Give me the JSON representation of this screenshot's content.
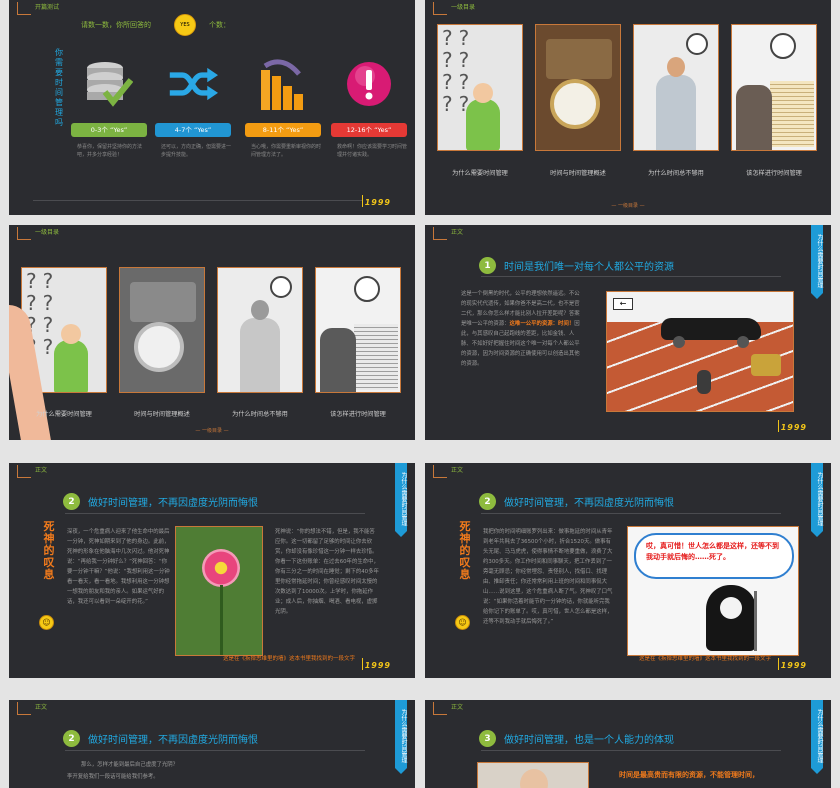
{
  "slide1": {
    "corner_label": "开篇测试",
    "quiz_prompt": "请数一数，你所回答的",
    "quiz_emoji": "YES",
    "quiz_unit": "个数：",
    "vertical_question": "你需要时间管理吗",
    "scores": [
      {
        "label": "0-3个 “Yes”",
        "color": "#7cb342",
        "icon": "database-check-icon",
        "desc": "恭喜你，保留并坚持你的方法吧，并多分享经验！"
      },
      {
        "label": "4-7个 “Yes”",
        "color": "#2196d3",
        "icon": "shuffle-icon",
        "desc": "还可以，方向正确，但需要进一步提升技能。"
      },
      {
        "label": "8-11个 “Yes”",
        "color": "#f39c12",
        "icon": "bar-chart-icon",
        "desc": "当心哦，你需要重新审视你的时间管理方法了。"
      },
      {
        "label": "12-16个 “Yes”",
        "color": "#e53935",
        "icon": "alert-icon",
        "desc": "救命啊！你应该需要学习时间管理并付诸实践。"
      }
    ],
    "logo": "1999"
  },
  "slide2": {
    "corner_label": "一级目录",
    "captions": [
      "为什么需要时间管理",
      "时间与时间管理概述",
      "为什么时间总不够用",
      "该怎样进行时间管理"
    ],
    "page_mark": "— 一级目录 —"
  },
  "slide3": {
    "corner_label": "一级目录",
    "captions": [
      "为什么需要时间管理",
      "时间与时间管理概述",
      "为什么时间总不够用",
      "该怎样进行时间管理"
    ],
    "page_mark": "— 一级目录 —"
  },
  "slide4": {
    "corner_label": "正文",
    "side_tab": "为什么需要时间管理",
    "number": "1",
    "heading": "时间是我们唯一对每个人都公平的资源",
    "body_before": "这是一个倒黑的时代，公平的理想依然遥远。不公的现实代代遗传，如果你爸不是高二代，也不是官二代，那么你怎么样才能比别人拉开差距呢？答案是唯一公平的资源：",
    "highlight": "这唯一公平的资源：时间！",
    "body_after": "因此，与其感叹自己起跑线的差距，比如金钱、人脉、不如好好把握住时间这个唯一对每个人都公平的资源，因为时间资源的正确使用可以创造出其他的资源。",
    "logo": "1999"
  },
  "slide5": {
    "corner_label": "正文",
    "side_tab": "为什么需要时间管理",
    "number": "2",
    "heading": "做好时间管理，不再因虚度光阴而悔恨",
    "death_title": "死神的叹息",
    "left_text": "深夜，一个危重病人迎来了他生命中的最后一分钟，死神如期来到了他的身边。此前，死神的形象在他脑海中几次闪过。他对死神说：“再给我一分钟好么？”死神回答：“你要一分钟干嘛？”他说：“我想利用这一分钟看一看天，看一看地。我想利用这一分钟想一想我的朋友和我的亲人。如果运气好的话，我还可以看到一朵绽开的花。”",
    "right_text": "死神说：“你的想法不错，但是，我不能答应你。这一切都留了足够的时间让你去欣赏，你却没有像珍惜这一分钟一样去珍惜。你看一下这份账单：在过去60年的生命中，你有三分之一的时间在睡觉；剩下的40多年里你经常拖延时间；你曾经感叹时间太慢的次数达到了10000次。上学时，你拖延作业；成人后，你抽烟、喝酒、看电视，虚掷光阴。",
    "caption": "这是在《拆掉思维里的墙》这本书里我找到的一段文字",
    "logo": "1999"
  },
  "slide6": {
    "corner_label": "正文",
    "side_tab": "为什么需要时间管理",
    "number": "2",
    "heading": "做好时间管理，不再因虚度光阴而悔恨",
    "death_title": "死神的叹息",
    "body": "我把你的时间明细账罗列出来：做事拖延的时间从青年到老年共耗去了36500个小时，折合1520天。做事有头无尾、马马虎虎，使得事情不断地要重做，浪费了大约300多天。你工作时间和同事聊天，把工作丢到了一旁毫无顾忌；你经常埋怨、责怪别人，找借口、找理由、推卸责任；你还常常利用上班的时间和同事侃大山……说到这里，这个危重病人断了气。死神叹了口气说：“如果你活着时能节约一分钟的话，你就能听完我给你记下的账单了。哎，真可惜，世人怎么都是这样，还等不到我动手就后悔死了。”",
    "speech": "哎，真可惜！世人怎么都是这样，还等不到我动手就后悔的……死了。",
    "caption": "这是在《拆掉思维里的墙》这本书里我找到的一段文字",
    "logo": "1999"
  },
  "slide7": {
    "corner_label": "正文",
    "side_tab": "为什么需要时间管理",
    "number": "2",
    "heading": "做好时间管理，不再因虚度光阴而悔恨",
    "body_line1": "那么，怎样才能到最后自己虚度了光阴？",
    "body_line2": "李开复给我们一段话可能给我们参考。"
  },
  "slide8": {
    "corner_label": "正文",
    "side_tab": "为什么需要时间管理",
    "number": "3",
    "heading": "做好时间管理，也是一个人能力的体现",
    "highlight": "时间是最高贵而有限的资源，不能管理时间，"
  }
}
